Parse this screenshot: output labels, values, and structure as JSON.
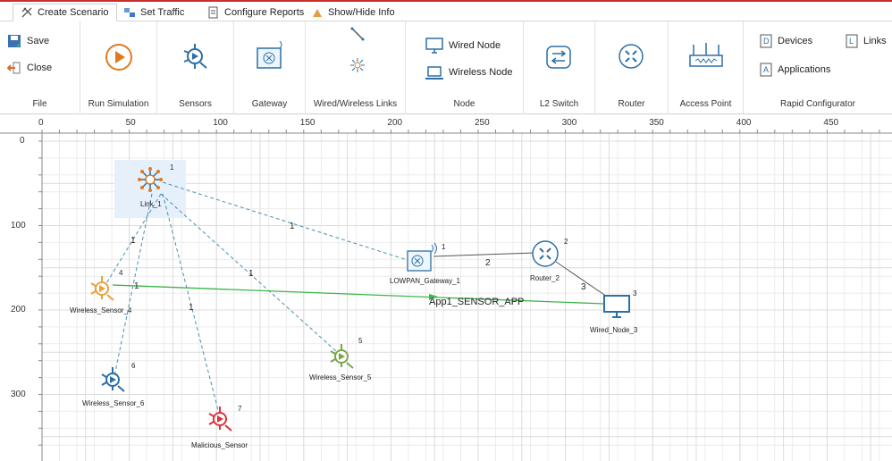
{
  "tabs": [
    {
      "label": "Create Scenario",
      "icon": "create-scenario-icon",
      "active": true
    },
    {
      "label": "Set Traffic",
      "icon": "traffic-icon"
    },
    {
      "label": "Configure Reports",
      "icon": "reports-icon"
    },
    {
      "label": "Show/Hide Info",
      "icon": "info-icon"
    }
  ],
  "ribbon": {
    "file": {
      "save": "Save",
      "close": "Close",
      "group": "File"
    },
    "run": {
      "group": "Run Simulation"
    },
    "sensors": {
      "group": "Sensors"
    },
    "gateway": {
      "group": "Gateway"
    },
    "links": {
      "group": "Wired/Wireless Links"
    },
    "node": {
      "wired": "Wired Node",
      "wireless": "Wireless Node",
      "group": "Node"
    },
    "l2switch": {
      "group": "L2 Switch"
    },
    "router": {
      "group": "Router"
    },
    "access_point": {
      "group": "Access Point"
    },
    "rapid": {
      "devices": "Devices",
      "links": "Links",
      "applications": "Applications",
      "group": "Rapid Configurator"
    }
  },
  "axis": {
    "x_ticks": [
      "0",
      "50",
      "100",
      "150",
      "200",
      "250",
      "300",
      "350",
      "400",
      "450"
    ],
    "y_ticks": [
      "0",
      "100",
      "200",
      "300"
    ]
  },
  "nodes": {
    "link1": {
      "label": "Link_1",
      "id": "1"
    },
    "gateway": {
      "label": "LOWPAN_Gateway_1",
      "id": "1"
    },
    "router": {
      "label": "Router_2",
      "id": "2"
    },
    "wired": {
      "label": "Wired_Node_3",
      "id": "3"
    },
    "sensor4": {
      "label": "Wireless_Sensor_4",
      "id": "4"
    },
    "sensor5": {
      "label": "Wireless_Sensor_5",
      "id": "5"
    },
    "sensor6": {
      "label": "Wireless_Sensor_6",
      "id": "6"
    },
    "malicious": {
      "label": "Malicious_Sensor",
      "id": "7"
    }
  },
  "links": {
    "l_gateway": "1",
    "l_sensor4": "1",
    "l_sensor5": "1",
    "l_malicious": "1",
    "gw_router": "2",
    "router_wired": "3"
  },
  "application": {
    "label": "App1_SENSOR_APP",
    "id": "1"
  },
  "colors": {
    "accent": "#c9302c",
    "app_line": "#3cb54a",
    "wireless_link": "#4a8fb0",
    "wired_link": "#555555",
    "sensor_orange": "#e8a23a",
    "sensor_green": "#7aa64a",
    "sensor_blue": "#2c6fa6",
    "sensor_red": "#d9323a"
  }
}
